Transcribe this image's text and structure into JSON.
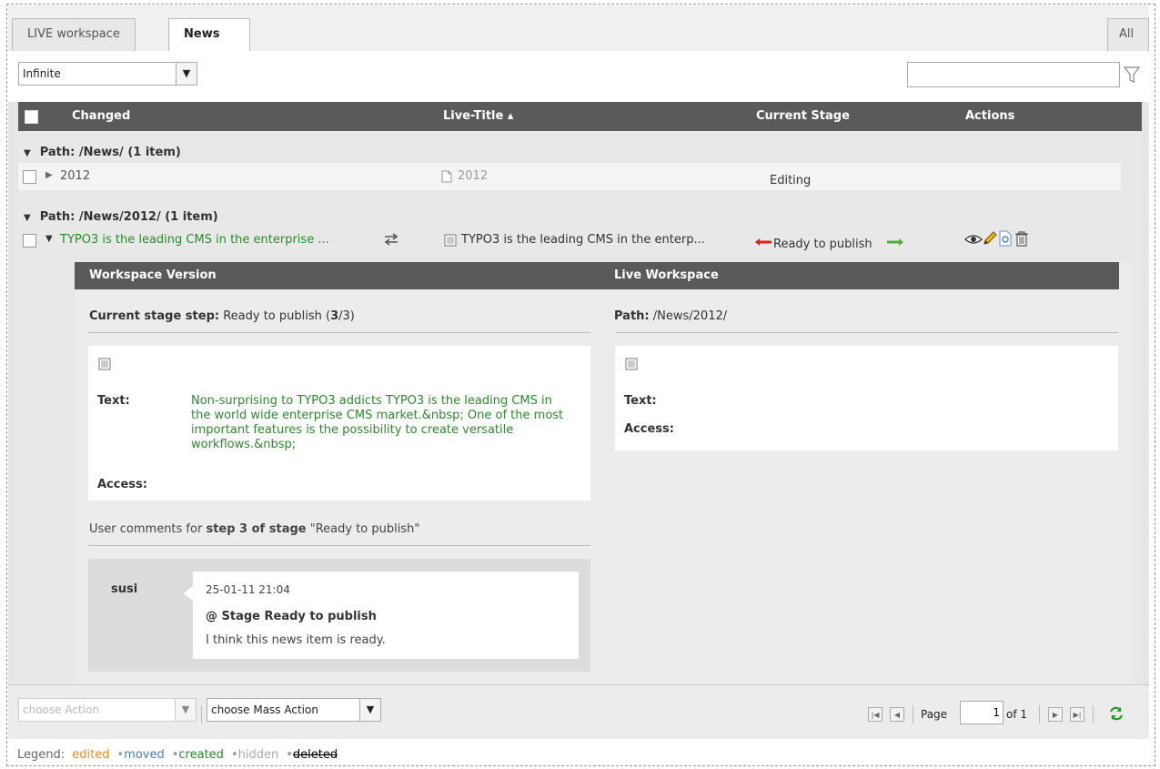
{
  "tabs": {
    "live": "LIVE workspace",
    "news": "News",
    "all": "All"
  },
  "toolbar": {
    "depth_value": "Infinite",
    "search_placeholder": ""
  },
  "grid": {
    "col_changed": "Changed",
    "col_live_title": "Live-Title ▴",
    "col_stage": "Current Stage",
    "col_actions": "Actions",
    "group1": "Path: /News/ (1 item)",
    "row1": {
      "changed": "2012",
      "live_title": "2012",
      "stage": "Editing"
    },
    "group2": "Path: /News/2012/ (1 item)",
    "row2": {
      "changed": "TYPO3 is the leading CMS in the enterprise ...",
      "live_title": "TYPO3 is the leading CMS in the enterp...",
      "stage": "Ready to publish"
    }
  },
  "detail": {
    "ws_header": "Workspace Version",
    "live_header": "Live Workspace",
    "stage_step_label": "Current stage step:",
    "stage_step_value": "Ready to publish (",
    "stage_step_num": "3",
    "stage_step_total": "/3)",
    "path_label": "Path:",
    "path_value": "/News/2012/",
    "text_label": "Text:",
    "access_label": "Access:",
    "ws_text": "Non-surprising to TYPO3 addicts TYPO3 is the leading CMS in the world wide enterprise CMS market.&nbsp; One of the most important features is the possibility to create versatile workflows.&nbsp;",
    "live_text_label": "Text:",
    "live_access_label": "Access:",
    "comments_prefix": "User comments for ",
    "comments_step": "step 3 of stage",
    "comments_suffix": " \"Ready to publish\"",
    "comment": {
      "user": "susi",
      "date": "25-01-11 21:04",
      "title": "@ Stage Ready to publish",
      "body": "I think this news item is ready."
    }
  },
  "footer": {
    "choose_action": "choose Action",
    "choose_mass_action": "choose Mass Action",
    "page_label": "Page",
    "page_value": "1",
    "page_of": "of 1"
  },
  "legend": {
    "label": "Legend:",
    "edited": "edited",
    "moved": "moved",
    "created": "created",
    "hidden": "hidden",
    "deleted": "deleted",
    "colors": {
      "edited": "#f18a1b",
      "moved": "#4a7fbf",
      "created": "#2c8a2c",
      "hidden": "#aaaaaa",
      "deleted": "#000000"
    }
  }
}
